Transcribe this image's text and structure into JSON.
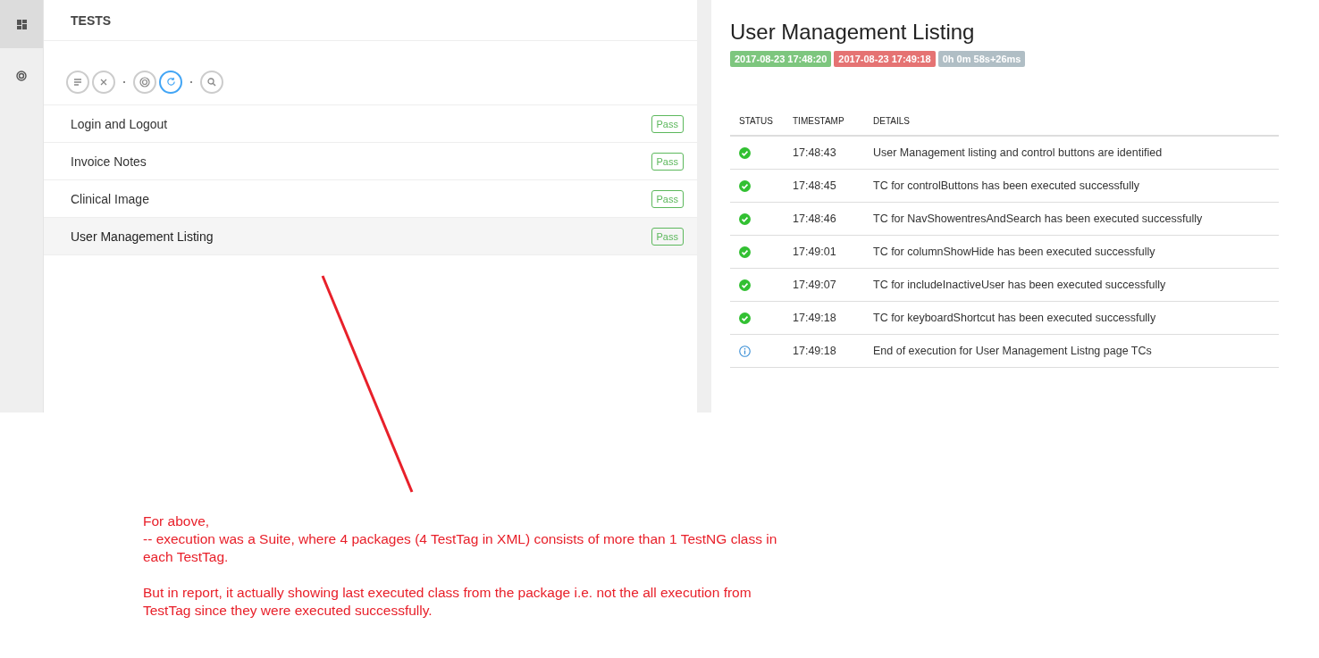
{
  "sidebar": {
    "items": [
      {
        "kind": "dashboard",
        "selected": true
      },
      {
        "kind": "tests",
        "selected": false
      }
    ]
  },
  "tests_panel": {
    "title": "TESTS",
    "filter_groups": [
      [
        {
          "kind": "list",
          "selected": false
        },
        {
          "kind": "fail",
          "selected": false
        }
      ],
      [
        {
          "kind": "radar",
          "selected": false
        },
        {
          "kind": "refresh",
          "selected": true
        }
      ],
      [
        {
          "kind": "search",
          "selected": false
        }
      ]
    ],
    "tests": [
      {
        "name": "Login and Logout",
        "status": "Pass",
        "selected": false
      },
      {
        "name": "Invoice Notes",
        "status": "Pass",
        "selected": false
      },
      {
        "name": "Clinical Image",
        "status": "Pass",
        "selected": false
      },
      {
        "name": "User Management Listing",
        "status": "Pass",
        "selected": true
      }
    ]
  },
  "detail": {
    "title": "User Management Listing",
    "badges": [
      {
        "text": "2017-08-23 17:48:20",
        "color": "#7dc67e"
      },
      {
        "text": "2017-08-23 17:49:18",
        "color": "#e57373"
      },
      {
        "text": "0h 0m 58s+26ms",
        "color": "#b0bec5"
      }
    ],
    "table": {
      "columns": [
        "STATUS",
        "TIMESTAMP",
        "DETAILS"
      ],
      "rows": [
        {
          "kind": "pass",
          "timestamp": "17:48:43",
          "details": "User Management listing and control buttons are identified"
        },
        {
          "kind": "pass",
          "timestamp": "17:48:45",
          "details": "TC for controlButtons has been executed successfully"
        },
        {
          "kind": "pass",
          "timestamp": "17:48:46",
          "details": "TC for NavShowentresAndSearch has been executed successfully"
        },
        {
          "kind": "pass",
          "timestamp": "17:49:01",
          "details": "TC for columnShowHide has been executed successfully"
        },
        {
          "kind": "pass",
          "timestamp": "17:49:07",
          "details": "TC for includeInactiveUser has been executed successfully"
        },
        {
          "kind": "pass",
          "timestamp": "17:49:18",
          "details": "TC for keyboardShortcut has been executed successfully"
        },
        {
          "kind": "info",
          "timestamp": "17:49:18",
          "details": "End of execution for User Management Listng page TCs"
        }
      ]
    }
  },
  "annotation": {
    "paragraphs": [
      [
        "For above,",
        "-- execution was a Suite, where 4 packages (4 TestTag in XML) consists of more than 1 TestNG class in each TestTag."
      ],
      [
        "But in report, it actually showing last executed class from the package i.e. not the all execution from TestTag since they were executed successfully."
      ]
    ]
  }
}
